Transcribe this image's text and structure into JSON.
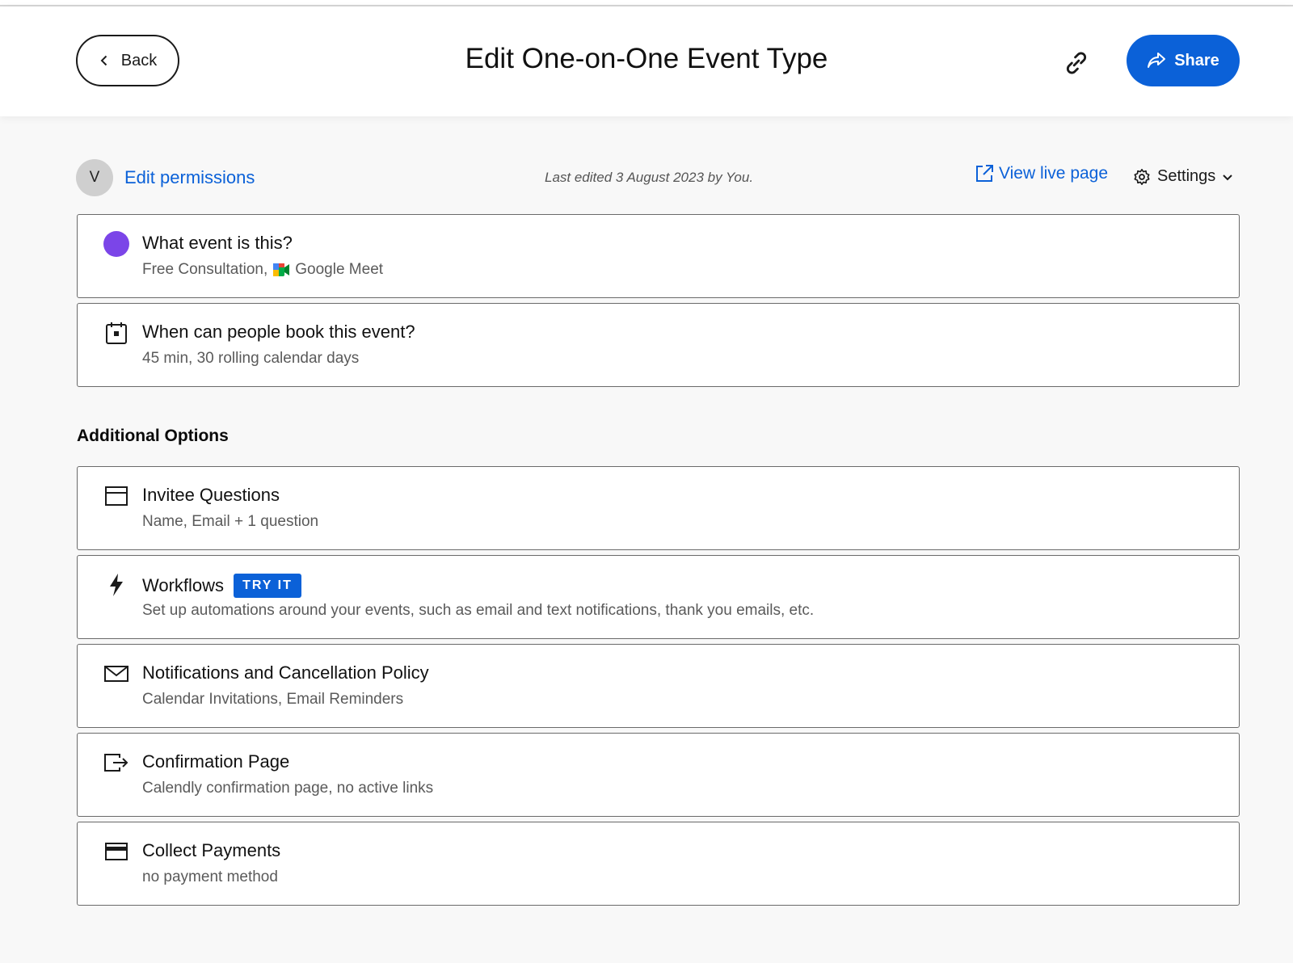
{
  "header": {
    "back_label": "Back",
    "title": "Edit One-on-One Event Type",
    "share_label": "Share"
  },
  "meta": {
    "avatar_initial": "V",
    "edit_permissions": "Edit permissions",
    "last_edited": "Last edited 3 August 2023 by You.",
    "view_live": "View live page",
    "settings": "Settings"
  },
  "event_cards": [
    {
      "icon": "event-color-dot-icon",
      "title": "What event is this?",
      "sub_prefix": "Free Consultation,",
      "sub_icon": "google-meet-icon",
      "sub_suffix": "Google Meet"
    },
    {
      "icon": "calendar-icon",
      "title": "When can people book this event?",
      "sub": "45 min, 30 rolling calendar days"
    }
  ],
  "additional": {
    "heading": "Additional Options",
    "items": [
      {
        "icon": "form-icon",
        "title": "Invitee Questions",
        "sub": "Name, Email + 1 question"
      },
      {
        "icon": "lightning-icon",
        "title": "Workflows",
        "badge": "TRY IT",
        "sub": "Set up automations around your events, such as email and text notifications, thank you emails, etc."
      },
      {
        "icon": "envelope-icon",
        "title": "Notifications and Cancellation Policy",
        "sub": "Calendar Invitations, Email Reminders"
      },
      {
        "icon": "exit-arrow-icon",
        "title": "Confirmation Page",
        "sub": "Calendly confirmation page, no active links"
      },
      {
        "icon": "credit-card-icon",
        "title": "Collect Payments",
        "sub": "no payment method"
      }
    ]
  },
  "colors": {
    "accent": "#0b61d8",
    "event_color": "#7b45e8"
  }
}
